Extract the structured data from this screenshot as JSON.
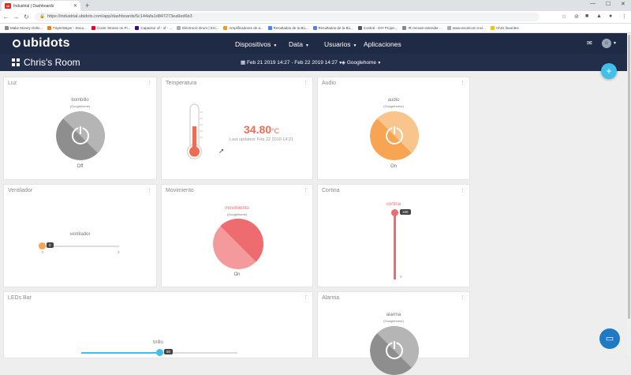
{
  "browser": {
    "tab_title": "Industrial | Dashboards",
    "tab_icon": "ubidots-favicon",
    "url": "https://industrial.ubidots.com/app/dashboards/5c144afa1d847273ea9ed6b3",
    "bookmarks": [
      {
        "label": "Make Money Onlin...",
        "color": "#888888"
      },
      {
        "label": "FayerWayer - Docu...",
        "color": "#e67e22"
      },
      {
        "label": "Cover Stones on Pi...",
        "color": "#e60023"
      },
      {
        "label": "Capacitor of - of - ...",
        "color": "#410093"
      },
      {
        "label": "Electronic Drum | Em...",
        "color": "#aaaaaa"
      },
      {
        "label": "Amplificadores de a...",
        "color": "#f39c12"
      },
      {
        "label": "Resultados de la Bú...",
        "color": "#4285f4"
      },
      {
        "label": "Resultados de la Bú...",
        "color": "#4285f4"
      },
      {
        "label": "Control - DIY Projec...",
        "color": "#555555"
      },
      {
        "label": "IR remote extender ...",
        "color": "#888888"
      },
      {
        "label": "www.excelcom.mx/...",
        "color": "#aaaaaa"
      },
      {
        "label": "Chris favorites",
        "color": "#f4c20d"
      }
    ]
  },
  "header": {
    "logo": "ubidots",
    "nav": [
      "Dispositivos",
      "Data",
      "Usuarios",
      "Aplicaciones"
    ],
    "dashboard_title": "Chris's Room",
    "date_range": "Feb 21 2019 14:27 - Feb 22 2019 14:27",
    "device_selector": "Googlehome"
  },
  "widgets": {
    "luz": {
      "title": "Luz",
      "variable": "bombillo",
      "device": "(Googlehome)",
      "state": "Off",
      "color": "#8e8e8e"
    },
    "temperatura": {
      "title": "Temperatura",
      "value": "34.80",
      "unit": "°C",
      "updated": "Last updated: Feb 22 2019 14:21",
      "color": "#ee6c55"
    },
    "audio": {
      "title": "Audio",
      "variable": "audio",
      "device": "(Googlehome)",
      "state": "On",
      "color": "#f7a552"
    },
    "ventilador": {
      "title": "Ventilador",
      "variable": "ventilador",
      "value": "0",
      "min": "0",
      "max": "3",
      "level": 0,
      "color": "#f7a552"
    },
    "movimiento": {
      "title": "Movimiento",
      "variable": "movimiento",
      "device": "(Googlehome)",
      "state": "On",
      "color": "#ee6c70"
    },
    "cortina": {
      "title": "Cortina",
      "variable": "cortina",
      "value": "100",
      "min": "0",
      "max": "100",
      "level": 1,
      "color": "#ee6c70"
    },
    "ledsbar": {
      "title": "LEDs Bar",
      "variable": "brillo",
      "value": "50",
      "level": 0.5,
      "color": "#40bfe8"
    },
    "alarma": {
      "title": "Alarma",
      "variable": "alarma",
      "device": "(Googlehome)",
      "color": "#8e8e8e"
    }
  }
}
